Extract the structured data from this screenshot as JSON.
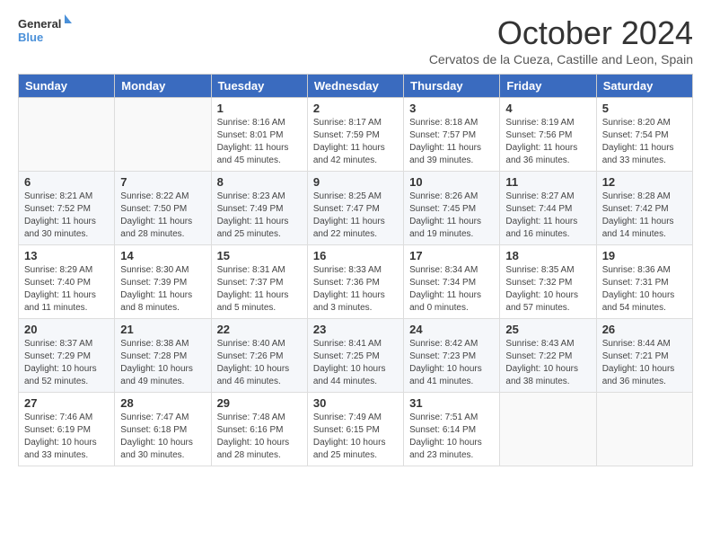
{
  "header": {
    "logo_general": "General",
    "logo_blue": "Blue",
    "title": "October 2024",
    "subtitle": "Cervatos de la Cueza, Castille and Leon, Spain"
  },
  "weekdays": [
    "Sunday",
    "Monday",
    "Tuesday",
    "Wednesday",
    "Thursday",
    "Friday",
    "Saturday"
  ],
  "weeks": [
    [
      {
        "day": "",
        "info": ""
      },
      {
        "day": "",
        "info": ""
      },
      {
        "day": "1",
        "info": "Sunrise: 8:16 AM\nSunset: 8:01 PM\nDaylight: 11 hours and 45 minutes."
      },
      {
        "day": "2",
        "info": "Sunrise: 8:17 AM\nSunset: 7:59 PM\nDaylight: 11 hours and 42 minutes."
      },
      {
        "day": "3",
        "info": "Sunrise: 8:18 AM\nSunset: 7:57 PM\nDaylight: 11 hours and 39 minutes."
      },
      {
        "day": "4",
        "info": "Sunrise: 8:19 AM\nSunset: 7:56 PM\nDaylight: 11 hours and 36 minutes."
      },
      {
        "day": "5",
        "info": "Sunrise: 8:20 AM\nSunset: 7:54 PM\nDaylight: 11 hours and 33 minutes."
      }
    ],
    [
      {
        "day": "6",
        "info": "Sunrise: 8:21 AM\nSunset: 7:52 PM\nDaylight: 11 hours and 30 minutes."
      },
      {
        "day": "7",
        "info": "Sunrise: 8:22 AM\nSunset: 7:50 PM\nDaylight: 11 hours and 28 minutes."
      },
      {
        "day": "8",
        "info": "Sunrise: 8:23 AM\nSunset: 7:49 PM\nDaylight: 11 hours and 25 minutes."
      },
      {
        "day": "9",
        "info": "Sunrise: 8:25 AM\nSunset: 7:47 PM\nDaylight: 11 hours and 22 minutes."
      },
      {
        "day": "10",
        "info": "Sunrise: 8:26 AM\nSunset: 7:45 PM\nDaylight: 11 hours and 19 minutes."
      },
      {
        "day": "11",
        "info": "Sunrise: 8:27 AM\nSunset: 7:44 PM\nDaylight: 11 hours and 16 minutes."
      },
      {
        "day": "12",
        "info": "Sunrise: 8:28 AM\nSunset: 7:42 PM\nDaylight: 11 hours and 14 minutes."
      }
    ],
    [
      {
        "day": "13",
        "info": "Sunrise: 8:29 AM\nSunset: 7:40 PM\nDaylight: 11 hours and 11 minutes."
      },
      {
        "day": "14",
        "info": "Sunrise: 8:30 AM\nSunset: 7:39 PM\nDaylight: 11 hours and 8 minutes."
      },
      {
        "day": "15",
        "info": "Sunrise: 8:31 AM\nSunset: 7:37 PM\nDaylight: 11 hours and 5 minutes."
      },
      {
        "day": "16",
        "info": "Sunrise: 8:33 AM\nSunset: 7:36 PM\nDaylight: 11 hours and 3 minutes."
      },
      {
        "day": "17",
        "info": "Sunrise: 8:34 AM\nSunset: 7:34 PM\nDaylight: 11 hours and 0 minutes."
      },
      {
        "day": "18",
        "info": "Sunrise: 8:35 AM\nSunset: 7:32 PM\nDaylight: 10 hours and 57 minutes."
      },
      {
        "day": "19",
        "info": "Sunrise: 8:36 AM\nSunset: 7:31 PM\nDaylight: 10 hours and 54 minutes."
      }
    ],
    [
      {
        "day": "20",
        "info": "Sunrise: 8:37 AM\nSunset: 7:29 PM\nDaylight: 10 hours and 52 minutes."
      },
      {
        "day": "21",
        "info": "Sunrise: 8:38 AM\nSunset: 7:28 PM\nDaylight: 10 hours and 49 minutes."
      },
      {
        "day": "22",
        "info": "Sunrise: 8:40 AM\nSunset: 7:26 PM\nDaylight: 10 hours and 46 minutes."
      },
      {
        "day": "23",
        "info": "Sunrise: 8:41 AM\nSunset: 7:25 PM\nDaylight: 10 hours and 44 minutes."
      },
      {
        "day": "24",
        "info": "Sunrise: 8:42 AM\nSunset: 7:23 PM\nDaylight: 10 hours and 41 minutes."
      },
      {
        "day": "25",
        "info": "Sunrise: 8:43 AM\nSunset: 7:22 PM\nDaylight: 10 hours and 38 minutes."
      },
      {
        "day": "26",
        "info": "Sunrise: 8:44 AM\nSunset: 7:21 PM\nDaylight: 10 hours and 36 minutes."
      }
    ],
    [
      {
        "day": "27",
        "info": "Sunrise: 7:46 AM\nSunset: 6:19 PM\nDaylight: 10 hours and 33 minutes."
      },
      {
        "day": "28",
        "info": "Sunrise: 7:47 AM\nSunset: 6:18 PM\nDaylight: 10 hours and 30 minutes."
      },
      {
        "day": "29",
        "info": "Sunrise: 7:48 AM\nSunset: 6:16 PM\nDaylight: 10 hours and 28 minutes."
      },
      {
        "day": "30",
        "info": "Sunrise: 7:49 AM\nSunset: 6:15 PM\nDaylight: 10 hours and 25 minutes."
      },
      {
        "day": "31",
        "info": "Sunrise: 7:51 AM\nSunset: 6:14 PM\nDaylight: 10 hours and 23 minutes."
      },
      {
        "day": "",
        "info": ""
      },
      {
        "day": "",
        "info": ""
      }
    ]
  ]
}
